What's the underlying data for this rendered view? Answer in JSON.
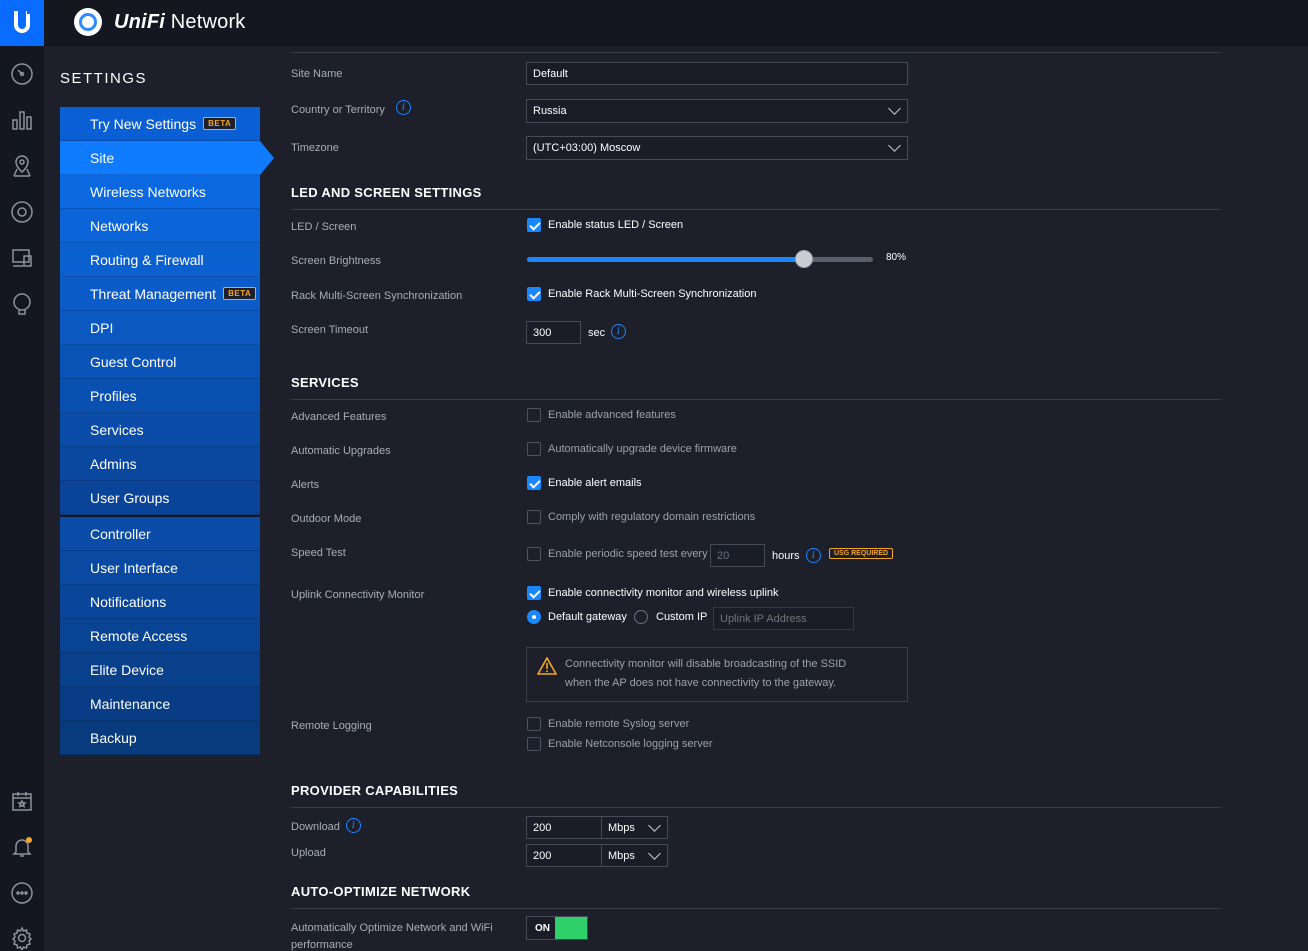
{
  "app": {
    "brand_prefix": "UniFi",
    "brand_suffix": " Network"
  },
  "settings_title": "SETTINGS",
  "nav": [
    {
      "label": "Try New Settings",
      "badge": "BETA",
      "bg": "#0a5fd4"
    },
    {
      "label": "Site",
      "badge": "",
      "bg": "#0f7cff",
      "active": true
    },
    {
      "label": "Wireless Networks",
      "badge": "",
      "bg": "#0b68e0"
    },
    {
      "label": "Networks",
      "badge": "",
      "bg": "#0b64d8"
    },
    {
      "label": "Routing & Firewall",
      "badge": "",
      "bg": "#0b60d0"
    },
    {
      "label": "Threat Management",
      "badge": "BETA",
      "bg": "#0b5cc8"
    },
    {
      "label": "DPI",
      "badge": "",
      "bg": "#0a58c0"
    },
    {
      "label": "Guest Control",
      "badge": "",
      "bg": "#0a54b8"
    },
    {
      "label": "Profiles",
      "badge": "",
      "bg": "#0a50b0"
    },
    {
      "label": "Services",
      "badge": "",
      "bg": "#0a4ca8"
    },
    {
      "label": "Admins",
      "badge": "",
      "bg": "#0a48a0"
    },
    {
      "label": "User Groups",
      "badge": "",
      "bg": "#094498"
    },
    {
      "sep": true
    },
    {
      "label": "Controller",
      "badge": "",
      "bg": "#0a4ca8"
    },
    {
      "label": "User Interface",
      "badge": "",
      "bg": "#0a49a1"
    },
    {
      "label": "Notifications",
      "badge": "",
      "bg": "#09469a"
    },
    {
      "label": "Remote Access",
      "badge": "",
      "bg": "#094393"
    },
    {
      "label": "Elite Device",
      "badge": "",
      "bg": "#09408c"
    },
    {
      "label": "Maintenance",
      "badge": "",
      "bg": "#083d85"
    },
    {
      "label": "Backup",
      "badge": "",
      "bg": "#083a7e"
    }
  ],
  "site": {
    "site_name_label": "Site Name",
    "site_name": "Default",
    "country_label": "Country or Territory",
    "country": "Russia",
    "timezone_label": "Timezone",
    "timezone": "(UTC+03:00) Moscow"
  },
  "led": {
    "title": "LED AND SCREEN SETTINGS",
    "led_label": "LED / Screen",
    "led_check": "Enable status LED / Screen",
    "led_checked": true,
    "brightness_label": "Screen Brightness",
    "brightness_value": "80%",
    "brightness_fraction": 0.8,
    "rack_label": "Rack Multi-Screen Synchronization",
    "rack_check": "Enable Rack Multi-Screen Synchronization",
    "rack_checked": true,
    "timeout_label": "Screen Timeout",
    "timeout_value": "300",
    "timeout_unit": "sec"
  },
  "services": {
    "title": "SERVICES",
    "advanced_label": "Advanced Features",
    "advanced_check": "Enable advanced features",
    "upgrades_label": "Automatic Upgrades",
    "upgrades_check": "Automatically upgrade device firmware",
    "alerts_label": "Alerts",
    "alerts_check": "Enable alert emails",
    "outdoor_label": "Outdoor Mode",
    "outdoor_check": "Comply with regulatory domain restrictions",
    "speed_label": "Speed Test",
    "speed_check": "Enable periodic speed test every",
    "speed_hours": "20",
    "speed_unit": "hours",
    "usg_badge": "USG REQUIRED",
    "uplink_label": "Uplink Connectivity Monitor",
    "uplink_check": "Enable connectivity monitor and wireless uplink",
    "default_gateway": "Default gateway",
    "custom_ip": "Custom IP",
    "uplink_placeholder": "Uplink IP Address",
    "warning_line1": "Connectivity monitor will disable broadcasting of the SSID",
    "warning_line2": "when the AP does not have connectivity to the gateway.",
    "logging_label": "Remote Logging",
    "syslog_check": "Enable remote Syslog server",
    "netconsole_check": "Enable Netconsole logging server"
  },
  "provider": {
    "title": "PROVIDER CAPABILITIES",
    "download_label": "Download",
    "download_value": "200",
    "download_unit": "Mbps",
    "upload_label": "Upload",
    "upload_value": "200",
    "upload_unit": "Mbps"
  },
  "auto": {
    "title": "AUTO-OPTIMIZE NETWORK",
    "label_line1": "Automatically Optimize Network and WiFi",
    "label_line2": "performance",
    "toggle": "ON"
  }
}
